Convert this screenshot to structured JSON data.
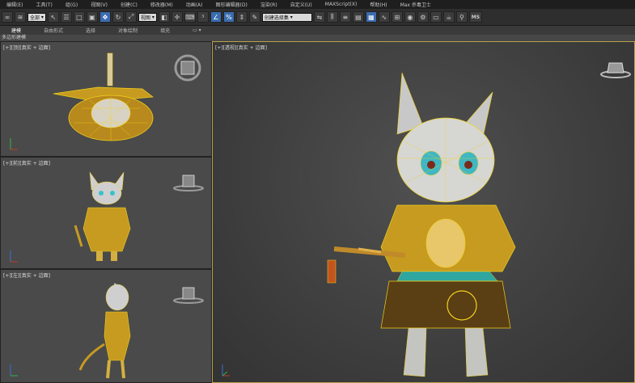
{
  "menu": {
    "items": [
      "编辑(E)",
      "工具(T)",
      "组(G)",
      "视图(V)",
      "创建(C)",
      "修改器(M)",
      "动画(A)",
      "图形编辑器(D)",
      "渲染(R)",
      "自定义(U)",
      "MAXScript(X)",
      "帮助(H)",
      "Max 杀毒卫士"
    ]
  },
  "toolbar": {
    "selection_filter": "全部",
    "coord_system": "视图",
    "named_selection": "创建选择集",
    "ms_label": "MS"
  },
  "ribbon": {
    "tabs": [
      "建模",
      "自由形式",
      "选择",
      "对象绘制",
      "填充"
    ],
    "active": "建模",
    "subpanel": "多边形建模"
  },
  "viewports": {
    "top": {
      "label": "[+][顶][真实 + 边面]"
    },
    "front": {
      "label": "[+][前][真实 + 边面]"
    },
    "left": {
      "label": "[+][左][真实 + 边面]"
    },
    "persp": {
      "label": "[+][透视][真实 + 边面]"
    }
  },
  "colors": {
    "active_border": "#b9a24a",
    "wire": "#f2d21b",
    "highlight": "#3a6cb0"
  }
}
